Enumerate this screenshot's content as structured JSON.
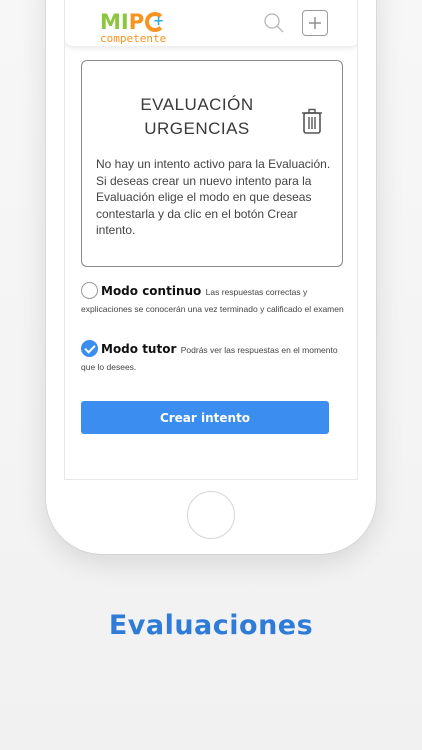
{
  "logo": {
    "main": "MIP",
    "sub": "competente"
  },
  "header": {
    "search_icon": "search-icon",
    "add_icon": "plus-square-icon"
  },
  "evaluation": {
    "title_line1": "EVALUACIÓN",
    "title_line2": "URGENCIAS",
    "delete_icon": "trash-icon",
    "message": "No hay un intento activo para la Evaluación.\nSi deseas crear un nuevo intento para la Evaluación elige el modo en que deseas contestarla y da clic en el botón Crear intento."
  },
  "modes": [
    {
      "name": "Modo continuo",
      "description": "Las respuestas correctas y explicaciones se conocerán una vez terminado y calificado el examen",
      "selected": false
    },
    {
      "name": "Modo tutor",
      "description": "Podrás ver las respuestas en el momento que lo desees.",
      "selected": true
    }
  ],
  "create_button": "Crear intento",
  "caption": "Evaluaciones",
  "colors": {
    "accent": "#3b8df0",
    "caption": "#2f7bd8",
    "logo_green": "#8cc63f",
    "logo_orange": "#f7931e",
    "logo_blue": "#29abe2"
  }
}
